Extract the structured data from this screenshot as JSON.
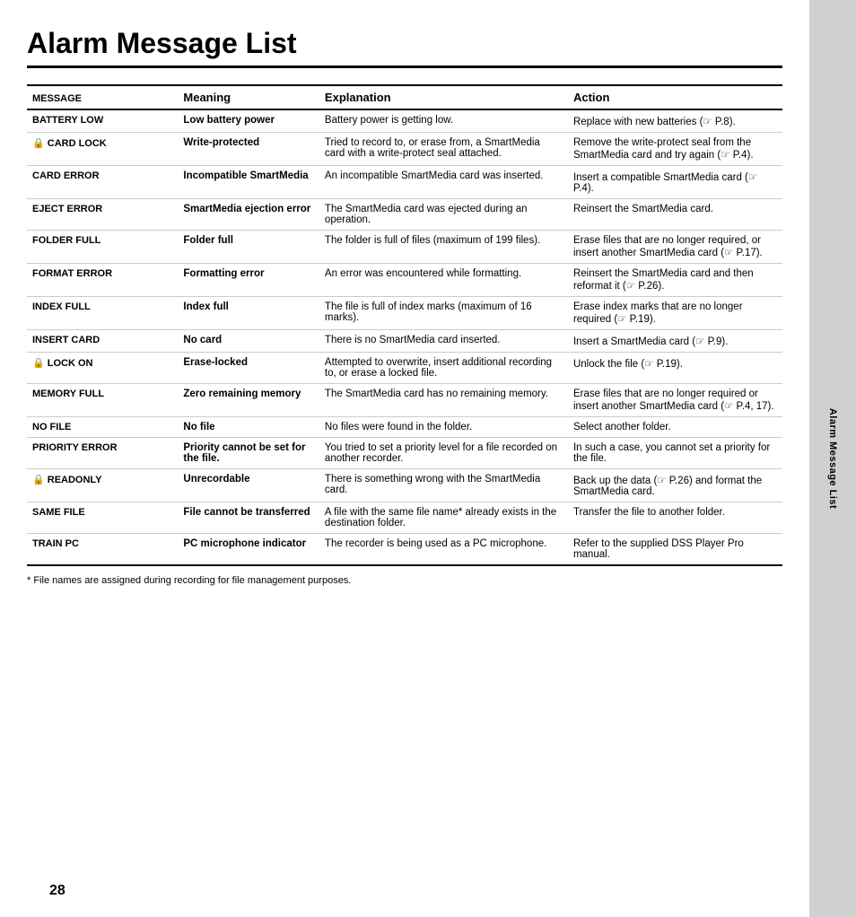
{
  "page": {
    "title": "Alarm Message List",
    "sidebar_label": "Alarm Message List",
    "page_number": "28",
    "footnote": "* File names are assigned during recording for file management purposes."
  },
  "table": {
    "headers": {
      "message": "Message",
      "meaning": "Meaning",
      "explanation": "Explanation",
      "action": "Action"
    },
    "rows": [
      {
        "message": "BATTERY LOW",
        "message_icon": "",
        "meaning": "Low battery power",
        "explanation": "Battery power is getting low.",
        "action": "Replace with new batteries (☞ P.8)."
      },
      {
        "message": "🔒 CARD LOCK",
        "message_icon": "lock",
        "meaning": "Write-protected",
        "explanation": "Tried to record to, or erase from, a SmartMedia card with a write-protect seal attached.",
        "action": "Remove the write-protect seal from the SmartMedia card and try again (☞ P.4)."
      },
      {
        "message": "CARD ERROR",
        "message_icon": "",
        "meaning": "Incompatible SmartMedia",
        "explanation": "An incompatible SmartMedia card was inserted.",
        "action": "Insert a compatible SmartMedia card (☞ P.4)."
      },
      {
        "message": "EJECT ERROR",
        "message_icon": "",
        "meaning": "SmartMedia ejection error",
        "explanation": "The SmartMedia card was ejected during an operation.",
        "action": "Reinsert the SmartMedia card."
      },
      {
        "message": "FOLDER FULL",
        "message_icon": "",
        "meaning": "Folder full",
        "explanation": "The folder is full of files (maximum of 199 files).",
        "action": "Erase files that are no longer required, or insert another SmartMedia card (☞ P.17)."
      },
      {
        "message": "FORMAT ERROR",
        "message_icon": "",
        "meaning": "Formatting error",
        "explanation": "An error was encountered while formatting.",
        "action": "Reinsert the SmartMedia card and then reformat it (☞ P.26)."
      },
      {
        "message": "INDEX FULL",
        "message_icon": "",
        "meaning": "Index full",
        "explanation": "The file is full of index marks (maximum of 16 marks).",
        "action": "Erase index marks that are no longer required (☞ P.19)."
      },
      {
        "message": "INSERT CARD",
        "message_icon": "",
        "meaning": "No card",
        "explanation": "There is no SmartMedia card inserted.",
        "action": "Insert a SmartMedia card (☞ P.9)."
      },
      {
        "message": "🔒 LOCK ON",
        "message_icon": "lock",
        "meaning": "Erase-locked",
        "explanation": "Attempted to overwrite, insert additional recording to, or erase a locked file.",
        "action": "Unlock the file (☞ P.19)."
      },
      {
        "message": "MEMORY FULL",
        "message_icon": "",
        "meaning": "Zero remaining memory",
        "explanation": "The SmartMedia card has no remaining memory.",
        "action": "Erase files that are no longer required or insert another SmartMedia card (☞ P.4, 17)."
      },
      {
        "message": "NO FILE",
        "message_icon": "",
        "meaning": "No file",
        "explanation": "No files were found in the folder.",
        "action": "Select another folder."
      },
      {
        "message": "PRIORITY ERROR",
        "message_icon": "",
        "meaning": "Priority cannot be set for the file.",
        "explanation": "You tried to set a priority level for a file recorded on another recorder.",
        "action": "In such a case, you cannot set a priority for the file."
      },
      {
        "message": "🔒 READONLY",
        "message_icon": "lock",
        "meaning": "Unrecordable",
        "explanation": "There is something wrong with the SmartMedia card.",
        "action": "Back up the data (☞ P.26) and format the SmartMedia card."
      },
      {
        "message": "SAME FILE",
        "message_icon": "",
        "meaning": "File cannot be transferred",
        "explanation": "A file with the same file name* already exists in the destination folder.",
        "action": "Transfer the file to another folder."
      },
      {
        "message": "TRAIN PC",
        "message_icon": "",
        "meaning": "PC microphone indicator",
        "explanation": "The recorder is being used as a PC microphone.",
        "action": "Refer to the supplied DSS Player Pro manual."
      }
    ]
  }
}
